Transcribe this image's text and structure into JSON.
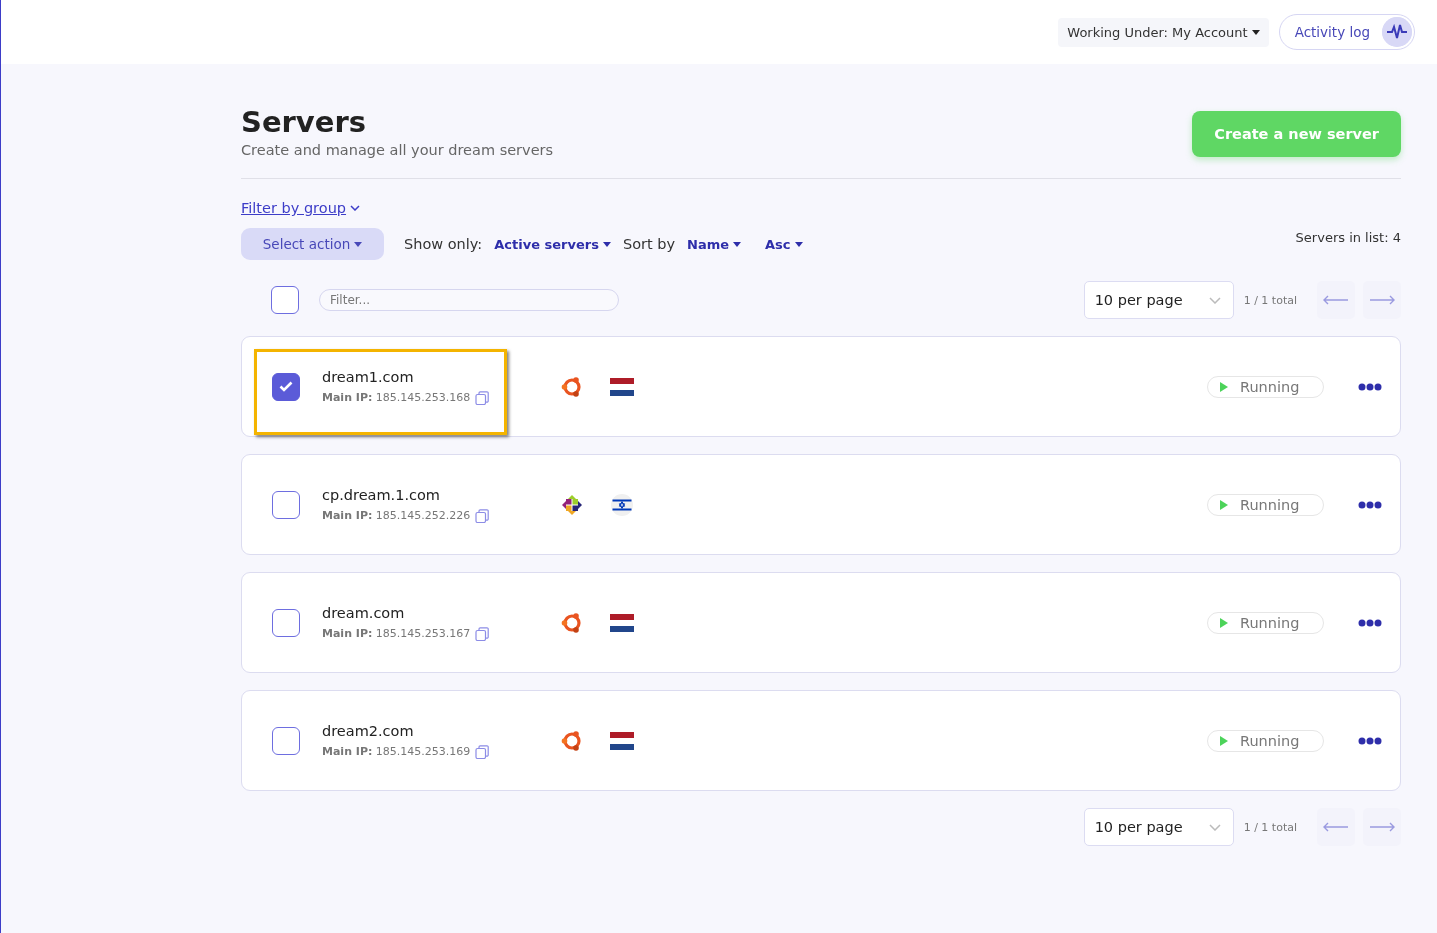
{
  "header": {
    "account_menu": "Working Under: My Account",
    "activity_button": "Activity log"
  },
  "page": {
    "title": "Servers",
    "subtitle": "Create and manage all your dream servers",
    "create_button": "Create a new server"
  },
  "toolbar": {
    "filter_group": "Filter by group",
    "select_action": "Select action",
    "show_only_label": "Show only:",
    "show_only_value": "Active servers",
    "sort_label": "Sort by",
    "sort_value": "Name",
    "order_value": "Asc",
    "count": "Servers in list: 4"
  },
  "list_header": {
    "select_all_checked": false,
    "filter_placeholder": "Filter...",
    "per_page": "10 per page",
    "pages": "1 / 1 total"
  },
  "servers": [
    {
      "name": "dream1.com",
      "ip_label": "Main IP:",
      "ip": "185.145.253.168",
      "os": {
        "kind": "ubuntu"
      },
      "flag": {
        "kind": "nl"
      },
      "status": "Running",
      "selected": true,
      "highlighted": true
    },
    {
      "name": "cp.dream.1.com",
      "ip_label": "Main IP:",
      "ip": "185.145.252.226",
      "os": {
        "kind": "centos"
      },
      "flag": {
        "kind": "il"
      },
      "status": "Running",
      "selected": false,
      "highlighted": false
    },
    {
      "name": "dream.com",
      "ip_label": "Main IP:",
      "ip": "185.145.253.167",
      "os": {
        "kind": "ubuntu"
      },
      "flag": {
        "kind": "nl"
      },
      "status": "Running",
      "selected": false,
      "highlighted": false
    },
    {
      "name": "dream2.com",
      "ip_label": "Main IP:",
      "ip": "185.145.253.169",
      "os": {
        "kind": "ubuntu"
      },
      "flag": {
        "kind": "nl"
      },
      "status": "Running",
      "selected": false,
      "highlighted": false
    }
  ],
  "footer": {
    "per_page": "10 per page",
    "pages": "1 / 1 total"
  }
}
